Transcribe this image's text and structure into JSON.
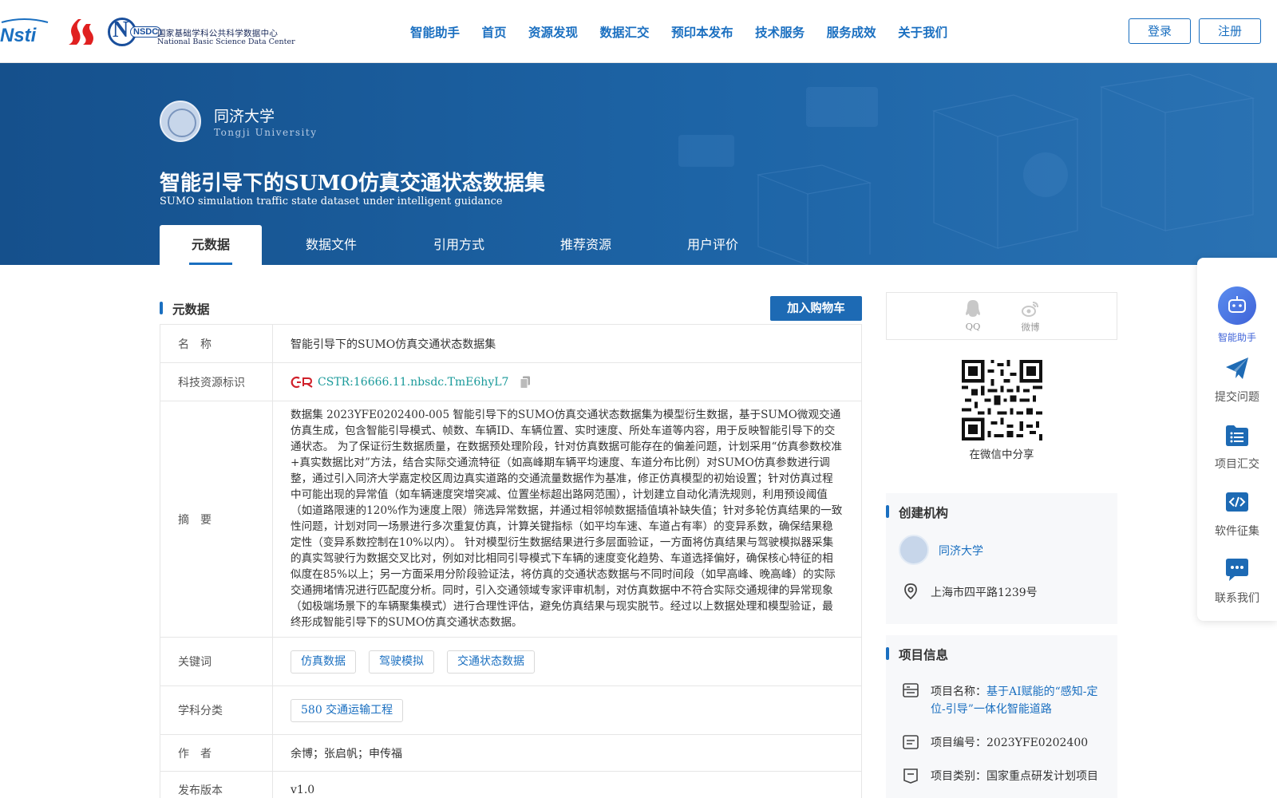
{
  "header": {
    "logos": {
      "nsti_text": "Nsti",
      "nsdc_letters": "NSDC",
      "nsdc_cn": "国家基础学科公共科学数据中心",
      "nsdc_en": "National Basic Science Data Center"
    },
    "menu": [
      "智能助手",
      "首页",
      "资源发现",
      "数据汇交",
      "预印本发布",
      "技术服务",
      "服务成效",
      "关于我们"
    ],
    "login_label": "登录",
    "register_label": "注册"
  },
  "banner": {
    "university_cn": "同济大学",
    "university_en": "Tongji University",
    "title": "智能引导下的SUMO仿真交通状态数据集",
    "subtitle": "SUMO simulation traffic state dataset under intelligent guidance",
    "tabs": [
      "元数据",
      "数据文件",
      "引用方式",
      "推荐资源",
      "用户评价"
    ],
    "active_tab": "元数据"
  },
  "metadata": {
    "section_title": "元数据",
    "cart_label": "加入购物车",
    "rows": {
      "name_label": "名　称",
      "name_value": "智能引导下的SUMO仿真交通状态数据集",
      "id_label": "科技资源标识",
      "id_value": "CSTR:16666.11.nbsdc.TmE6hyL7",
      "abstract_label": "摘　要",
      "abstract_value": "数据集 2023YFE0202400-005 智能引导下的SUMO仿真交通状态数据集为模型衍生数据，基于SUMO微观交通仿真生成，包含智能引导模式、帧数、车辆ID、车辆位置、实时速度、所处车道等内容，用于反映智能引导下的交通状态。 为了保证衍生数据质量，在数据预处理阶段，针对仿真数据可能存在的偏差问题，计划采用“仿真参数校准+真实数据比对”方法，结合实际交通流特征（如高峰期车辆平均速度、车道分布比例）对SUMO仿真参数进行调整，通过引入同济大学嘉定校区周边真实道路的交通流量数据作为基准，修正仿真模型的初始设置；针对仿真过程中可能出现的异常值（如车辆速度突增突减、位置坐标超出路网范围），计划建立自动化清洗规则，利用预设阈值（如道路限速的120%作为速度上限）筛选异常数据，并通过相邻帧数据插值填补缺失值；针对多轮仿真结果的一致性问题，计划对同一场景进行多次重复仿真，计算关键指标（如平均车速、车道占有率）的变异系数，确保结果稳定性（变异系数控制在10%以内）。 针对模型衍生数据结果进行多层面验证，一方面将仿真结果与驾驶模拟器采集的真实驾驶行为数据交叉比对，例如对比相同引导模式下车辆的速度变化趋势、车道选择偏好，确保核心特征的相似度在85%以上；另一方面采用分阶段验证法，将仿真的交通状态数据与不同时间段（如早高峰、晚高峰）的实际交通拥堵情况进行匹配度分析。同时，引入交通领域专家评审机制，对仿真数据中不符合实际交通规律的异常现象（如极端场景下的车辆聚集模式）进行合理性评估，避免仿真结果与现实脱节。经过以上数据处理和模型验证，最终形成智能引导下的SUMO仿真交通状态数据。",
      "keywords_label": "关键词",
      "keywords": [
        "仿真数据",
        "驾驶模拟",
        "交通状态数据"
      ],
      "subject_label": "学科分类",
      "subject_value": "580 交通运输工程",
      "author_label": "作　者",
      "author_value": "余博；张启帆；申传福",
      "version_label": "发布版本",
      "version_value": "v1.0"
    }
  },
  "sidebar": {
    "share": {
      "qq_label": "QQ",
      "weibo_label": "微博"
    },
    "qr_caption": "在微信中分享",
    "org": {
      "title": "创建机构",
      "name": "同济大学",
      "address": "上海市四平路1239号"
    },
    "project": {
      "title": "项目信息",
      "name_prefix": "项目名称：",
      "name_line1": "基于AI赋能的“感知-定",
      "name_line2": "位-引导”一体化智能道路",
      "number": "项目编号：2023YFE0202400",
      "category": "项目类别：国家重点研发计划项目"
    }
  },
  "floating": {
    "items": [
      "智能助手",
      "提交问题",
      "项目汇交",
      "软件征集",
      "联系我们"
    ]
  },
  "colors": {
    "brand_blue": "#1a6fc0",
    "banner_blue": "#1d64a6",
    "cstr_teal": "#1a9a9a"
  }
}
